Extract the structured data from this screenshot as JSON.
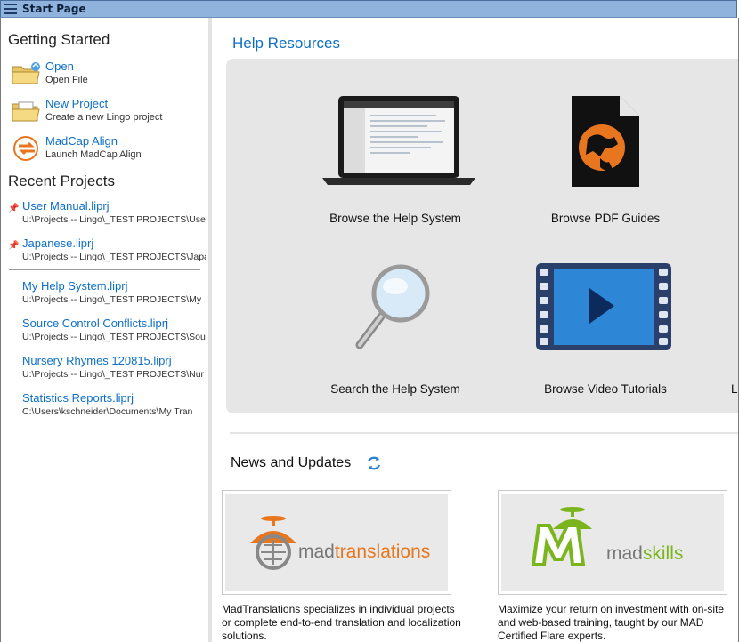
{
  "window": {
    "title": "Start Page"
  },
  "getting_started": {
    "heading": "Getting Started",
    "items": [
      {
        "label": "Open",
        "sub": "Open File",
        "icon": "folder-open-icon"
      },
      {
        "label": "New Project",
        "sub": "Create a new Lingo project",
        "icon": "folder-new-icon"
      },
      {
        "label": "MadCap Align",
        "sub": "Launch MadCap Align",
        "icon": "align-icon"
      }
    ]
  },
  "recent_projects": {
    "heading": "Recent Projects",
    "pinned": [
      {
        "name": "User Manual.liprj",
        "path": "U:\\Projects -- Lingo\\_TEST PROJECTS\\User"
      },
      {
        "name": "Japanese.liprj",
        "path": "U:\\Projects -- Lingo\\_TEST PROJECTS\\Japa"
      }
    ],
    "items": [
      {
        "name": "My Help System.liprj",
        "path": "U:\\Projects -- Lingo\\_TEST PROJECTS\\My"
      },
      {
        "name": "Source Control Conflicts.liprj",
        "path": "U:\\Projects -- Lingo\\_TEST PROJECTS\\Sou"
      },
      {
        "name": "Nursery Rhymes 120815.liprj",
        "path": "U:\\Projects -- Lingo\\_TEST PROJECTS\\Nur"
      },
      {
        "name": "Statistics Reports.liprj",
        "path": "C:\\Users\\kschneider\\Documents\\My Tran"
      }
    ]
  },
  "help_resources": {
    "heading": "Help Resources",
    "tiles": [
      {
        "label": "Browse the Help System",
        "icon": "laptop-icon"
      },
      {
        "label": "Browse PDF Guides",
        "icon": "pdf-guide-icon"
      },
      {
        "label": "Search the Help System",
        "icon": "magnifier-icon"
      },
      {
        "label": "Browse Video Tutorials",
        "icon": "video-icon"
      },
      {
        "label": "L"
      }
    ]
  },
  "news": {
    "heading": "News and Updates",
    "cards": [
      {
        "logo_a": "mad",
        "logo_b": "translations",
        "text": "MadTranslations specializes in individual projects or complete end-to-end translation and localization solutions."
      },
      {
        "logo_a": "mad",
        "logo_b": "skills",
        "text": "Maximize your return on investment with on-site and web-based training, taught by our MAD Certified Flare experts."
      }
    ]
  },
  "colors": {
    "link": "#0e6fc7",
    "accent_orange": "#e8761e",
    "accent_green": "#7ab51d"
  }
}
